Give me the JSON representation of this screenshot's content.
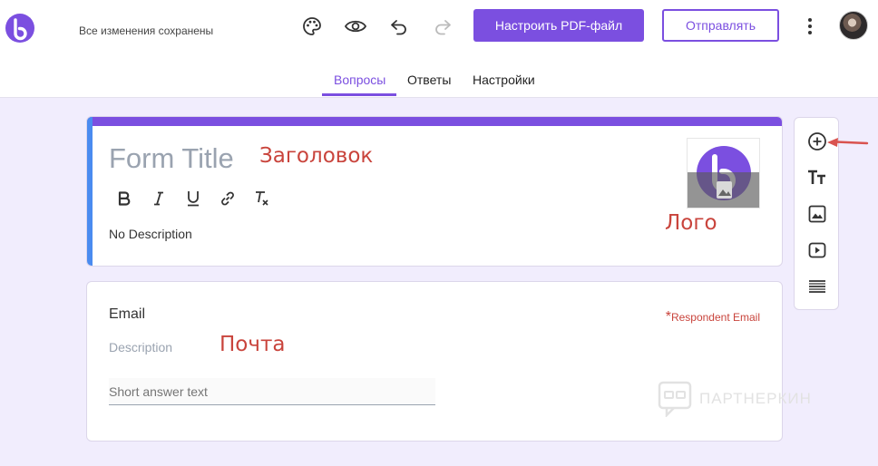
{
  "header": {
    "save_status": "Все изменения сохранены",
    "primary_button": "Настроить PDF-файл",
    "outline_button": "Отправлять"
  },
  "tabs": [
    {
      "label": "Вопросы",
      "active": true
    },
    {
      "label": "Ответы",
      "active": false
    },
    {
      "label": "Настройки",
      "active": false
    }
  ],
  "form": {
    "title_placeholder": "Form Title",
    "description": "No Description",
    "formatting": [
      "bold-icon",
      "italic-icon",
      "underline-icon",
      "link-icon",
      "clear-format-icon"
    ]
  },
  "email_question": {
    "label": "Email",
    "description_placeholder": "Description",
    "required_label": "Respondent Email",
    "required_mark": "*",
    "answer_placeholder": "Short answer text"
  },
  "annotations": {
    "title": "Заголовок",
    "logo": "Лого",
    "email": "Почта"
  },
  "side_toolbar": [
    "add-question-icon",
    "add-title-icon",
    "add-image-icon",
    "add-video-icon",
    "add-section-icon"
  ],
  "watermark": "ПАРТНЕРКИН",
  "colors": {
    "accent": "#7b4fe0",
    "annotation": "#c9443c",
    "background": "#f1edfd",
    "left_stripe": "#4a8bf0"
  }
}
